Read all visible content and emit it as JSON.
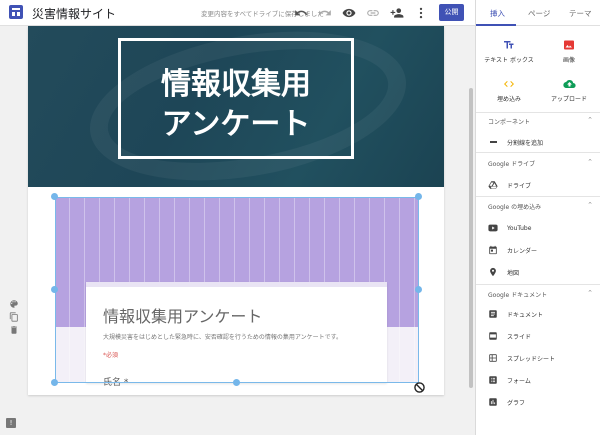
{
  "app": {
    "site_title": "災害情報サイト",
    "save_hint": "変更内容をすべてドライブに保存しました",
    "publish_label": "公開"
  },
  "panel": {
    "tabs": [
      "挿入",
      "ページ",
      "テーマ"
    ],
    "tiles": [
      {
        "label": "テキスト ボックス",
        "icon": "text-box-icon"
      },
      {
        "label": "画像",
        "icon": "image-icon"
      },
      {
        "label": "埋め込み",
        "icon": "embed-icon"
      },
      {
        "label": "アップロード",
        "icon": "upload-icon"
      }
    ],
    "sections": {
      "components": {
        "title": "コンポーネント",
        "items": [
          "分割線を追加"
        ]
      },
      "drive": {
        "title": "Google ドライブ",
        "items": [
          "ドライブ"
        ]
      },
      "embeds": {
        "title": "Google の埋め込み",
        "items": [
          "YouTube",
          "カレンダー",
          "地図"
        ]
      },
      "docs": {
        "title": "Google ドキュメント",
        "items": [
          "ドキュメント",
          "スライド",
          "スプレッドシート",
          "フォーム",
          "グラフ"
        ]
      }
    }
  },
  "page": {
    "hero_title_line1": "情報収集用",
    "hero_title_line2": "アンケート",
    "form": {
      "title": "情報収集用アンケート",
      "description": "大規模災害をはじめとした緊急時に、安否確認を行うための情報の集用アンケートです。",
      "required_note": "*必須",
      "first_field": "氏名 *"
    }
  },
  "colors": {
    "accent": "#3f51b5",
    "hero_bg": "#234b5b",
    "embed_purple": "#b6a2e0",
    "selection": "#74b6ea"
  }
}
